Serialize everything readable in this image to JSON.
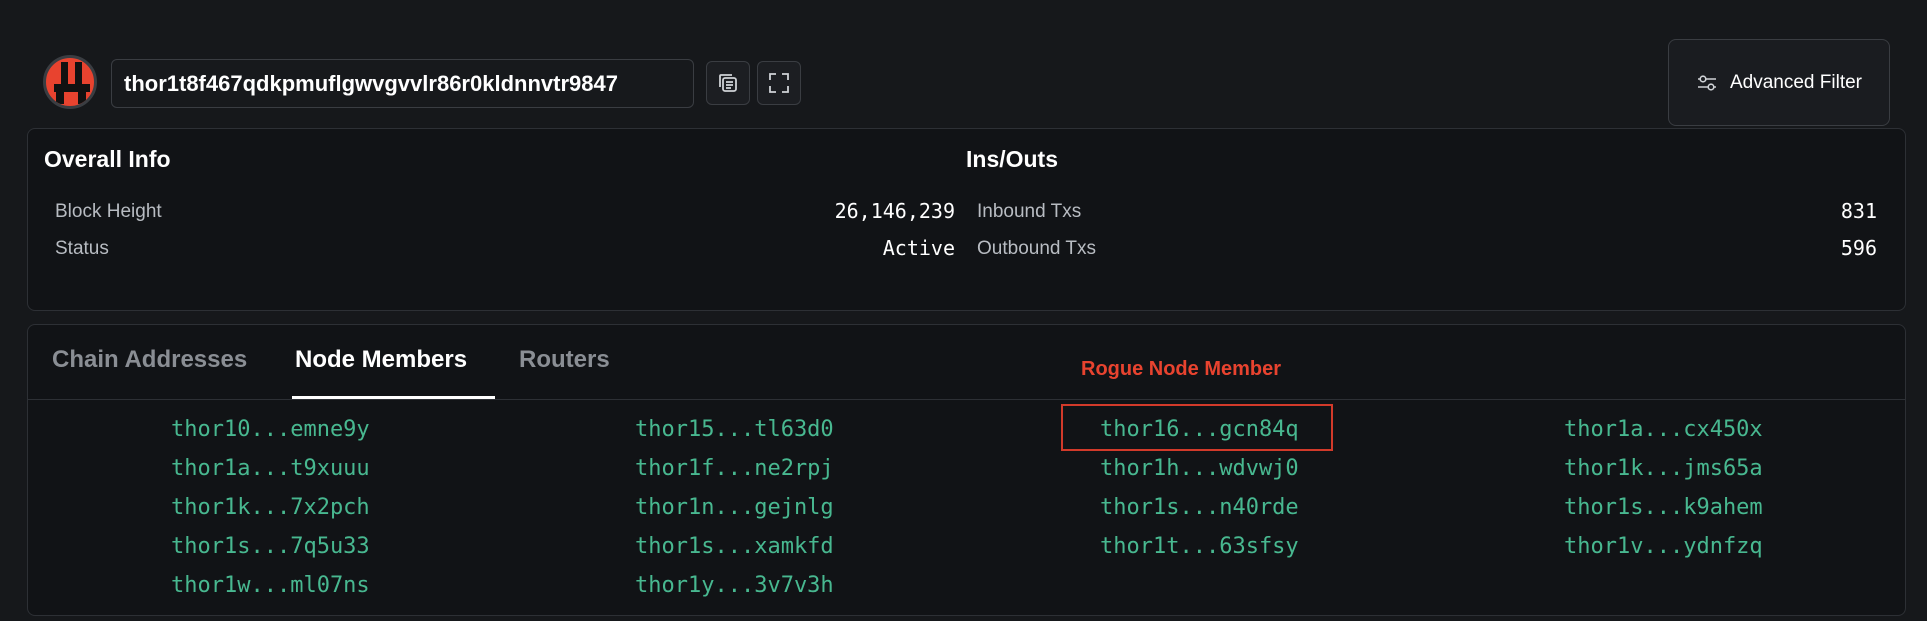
{
  "header": {
    "address": "thor1t8f467qdkpmuflgwvgvvlr86r0kldnnvtr9847",
    "logo_icon": "thorchain-logo",
    "copy_icon": "copy-icon",
    "expand_icon": "expand-icon",
    "filter_label": "Advanced Filter",
    "filter_icon": "sliders-icon"
  },
  "overview": {
    "overall": {
      "title": "Overall Info",
      "rows": [
        {
          "label": "Block Height",
          "value": "26,146,239"
        },
        {
          "label": "Status",
          "value": "Active"
        }
      ]
    },
    "insouts": {
      "title": "Ins/Outs",
      "rows": [
        {
          "label": "Inbound Txs",
          "value": "831"
        },
        {
          "label": "Outbound Txs",
          "value": "596"
        }
      ]
    }
  },
  "tabs": [
    {
      "label": "Chain Addresses",
      "active": false
    },
    {
      "label": "Node Members",
      "active": true
    },
    {
      "label": "Routers",
      "active": false
    }
  ],
  "annotation": {
    "label": "Rogue Node Member",
    "color": "#e8432f"
  },
  "members": {
    "columns": [
      [
        "thor10...emne9y",
        "thor1a...t9xuuu",
        "thor1k...7x2pch",
        "thor1s...7q5u33",
        "thor1w...ml07ns"
      ],
      [
        "thor15...tl63d0",
        "thor1f...ne2rpj",
        "thor1n...gejnlg",
        "thor1s...xamkfd",
        "thor1y...3v7v3h"
      ],
      [
        "thor16...gcn84q",
        "thor1h...wdvwj0",
        "thor1s...n40rde",
        "thor1t...63sfsy"
      ],
      [
        "thor1a...cx450x",
        "thor1k...jms65a",
        "thor1s...k9ahem",
        "thor1v...ydnfzq"
      ]
    ],
    "color": "#48b890"
  }
}
